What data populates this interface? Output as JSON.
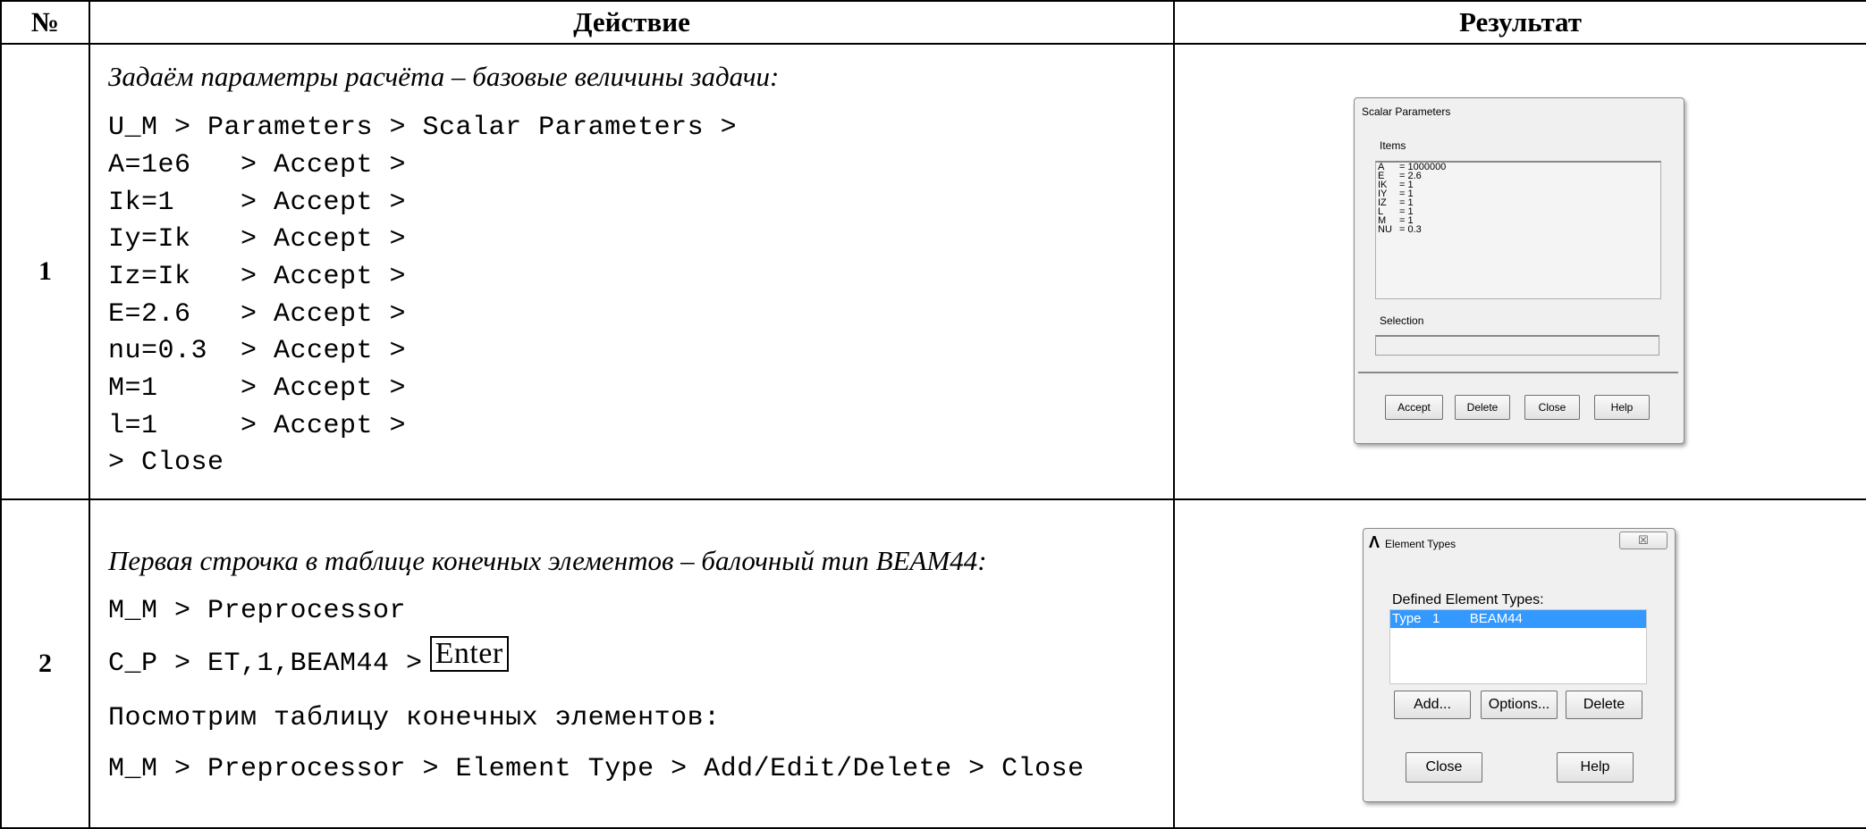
{
  "headers": {
    "num": "№",
    "action": "Действие",
    "result": "Результат"
  },
  "rows": [
    {
      "num": "1",
      "intro": "Задаём параметры расчёта – базовые величины задачи:",
      "lines": [
        "U_M > Parameters > Scalar Parameters >",
        "A=1e6   > Accept >",
        "Ik=1    > Accept >",
        "Iy=Ik   > Accept >",
        "Iz=Ik   > Accept >",
        "E=2.6   > Accept >",
        "nu=0.3  > Accept >",
        "M=1     > Accept >",
        "l=1     > Accept >",
        "> Close"
      ]
    },
    {
      "num": "2",
      "intro": "Первая строчка в таблице конечных элементов – балочный тип BEAM44:",
      "line1": "M_M > Preprocessor",
      "line2": "C_P > ET,1,BEAM44 >",
      "enter": "Enter",
      "line3": "Посмотрим таблицу конечных элементов:",
      "line4": "M_M > Preprocessor > Element Type > Add/Edit/Delete > Close"
    }
  ],
  "scalar_dialog": {
    "title": "Scalar Parameters",
    "items_label": "Items",
    "items": [
      {
        "name": "A",
        "value": "= 1000000"
      },
      {
        "name": "E",
        "value": "= 2.6"
      },
      {
        "name": "IK",
        "value": "= 1"
      },
      {
        "name": "IY",
        "value": "= 1"
      },
      {
        "name": "IZ",
        "value": "= 1"
      },
      {
        "name": "L",
        "value": "= 1"
      },
      {
        "name": "M",
        "value": "= 1"
      },
      {
        "name": "NU",
        "value": "= 0.3"
      }
    ],
    "selection_label": "Selection",
    "buttons": {
      "accept": "Accept",
      "delete": "Delete",
      "close": "Close",
      "help": "Help"
    }
  },
  "element_dialog": {
    "title": "Element Types",
    "close_glyph": "☒",
    "logo": "Λ",
    "defined_label": "Defined Element Types:",
    "selected_item": "Type   1        BEAM44",
    "buttons": {
      "add": "Add...",
      "options": "Options...",
      "delete": "Delete",
      "close": "Close",
      "help": "Help"
    }
  }
}
